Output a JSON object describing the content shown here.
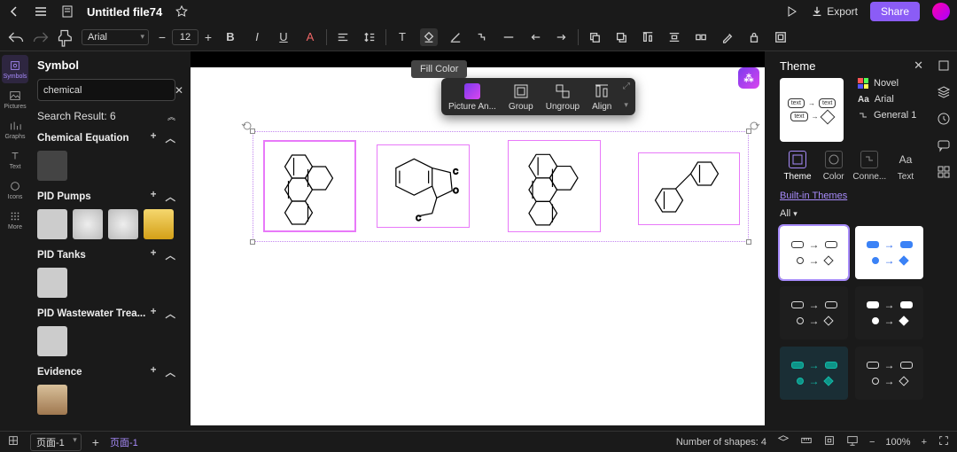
{
  "topbar": {
    "file_title": "Untitled file74",
    "export_label": "Export",
    "share_label": "Share"
  },
  "toolbar": {
    "font_name": "Arial",
    "font_size": "12",
    "fill_tooltip": "Fill Color"
  },
  "leftrail": {
    "items": [
      "Symbols",
      "Pictures",
      "Graphs",
      "Text",
      "Icons",
      "More"
    ]
  },
  "symbol_panel": {
    "title": "Symbol",
    "search_value": "chemical",
    "search_result": "Search Result: 6",
    "sections": [
      {
        "title": "Chemical Equation"
      },
      {
        "title": "PID Pumps"
      },
      {
        "title": "PID Tanks"
      },
      {
        "title": "PID Wastewater Trea..."
      },
      {
        "title": "Evidence"
      }
    ]
  },
  "context_toolbar": {
    "items": [
      "Picture An...",
      "Group",
      "Ungroup",
      "Align"
    ]
  },
  "right_panel": {
    "title": "Theme",
    "novel": "Novel",
    "font": "Arial",
    "connector": "General 1",
    "cats": [
      "Theme",
      "Color",
      "Conne...",
      "Text"
    ],
    "builtin": "Built-in Themes",
    "all": "All"
  },
  "bottombar": {
    "page_select": "页面-1",
    "page_tab": "页面-1",
    "shape_count": "Number of shapes: 4",
    "zoom": "100%"
  }
}
